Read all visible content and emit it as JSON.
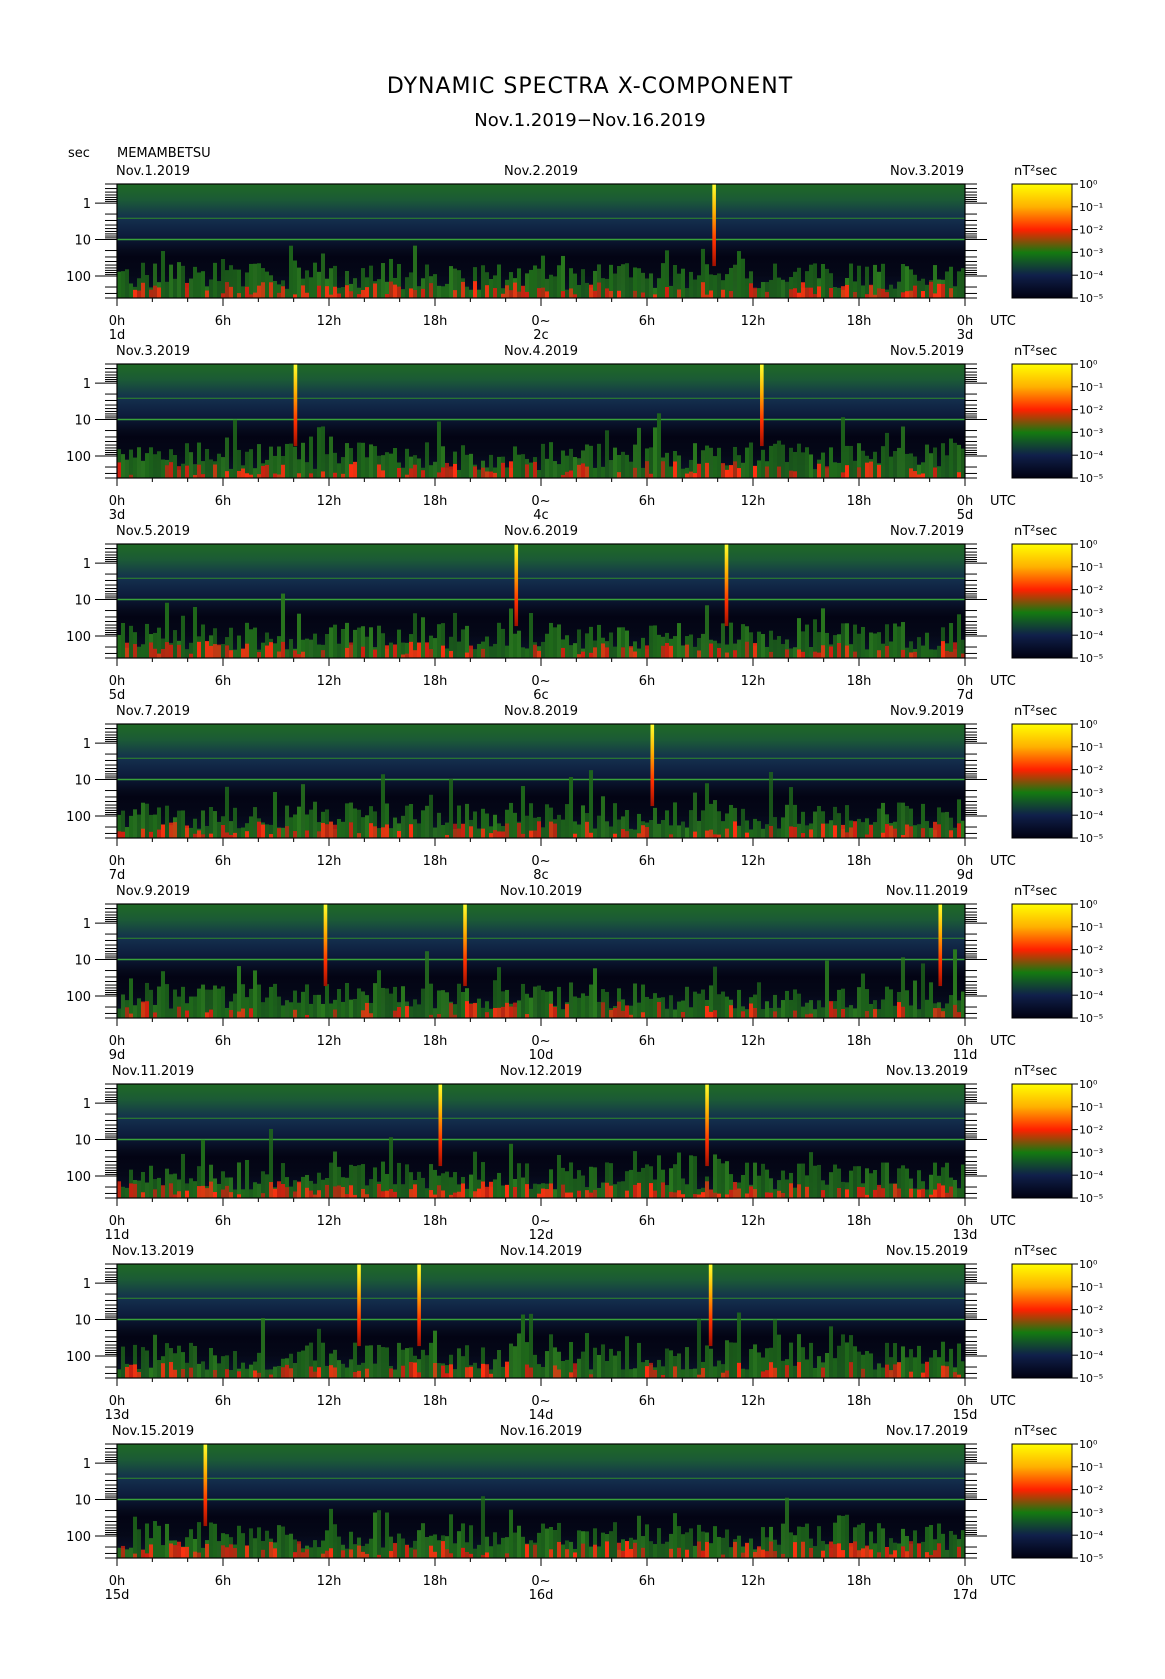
{
  "header": {
    "title": "DYNAMIC SPECTRA X-COMPONENT",
    "subtitle": "Nov.1.2019−Nov.16.2019",
    "axis_unit": "sec",
    "station": "MEMAMBETSU"
  },
  "chart_data": {
    "type": "heatmap",
    "y_axis": {
      "label": "sec",
      "scale": "log",
      "ticks": [
        "1",
        "10",
        "100"
      ],
      "ylim": [
        0.3,
        400
      ]
    },
    "x_ticks": [
      "0h",
      "6h",
      "12h",
      "18h",
      "0~",
      "6h",
      "12h",
      "18h",
      "0h"
    ],
    "time_zone": "UTC",
    "colorbar": {
      "unit": "nT²sec",
      "labels": [
        "10⁰",
        "10⁻¹",
        "10⁻²",
        "10⁻³",
        "10⁻⁴",
        "10⁻⁵"
      ],
      "colors": [
        "#ffff00",
        "#ffb000",
        "#ff2000",
        "#147a10",
        "#10204a",
        "#000010"
      ]
    },
    "panels": [
      {
        "start_date": "Nov.1.2019",
        "mid_date": "Nov.2.2019",
        "end_date": "Nov.3.2019",
        "day_labels": [
          "1d",
          "2c",
          "3d"
        ],
        "spikes_hours": [
          33.8
        ],
        "red_intensity": 0.5
      },
      {
        "start_date": "Nov.3.2019",
        "mid_date": "Nov.4.2019",
        "end_date": "Nov.5.2019",
        "day_labels": [
          "3d",
          "4c",
          "5d"
        ],
        "spikes_hours": [
          10.1,
          36.5
        ],
        "red_intensity": 0.4
      },
      {
        "start_date": "Nov.5.2019",
        "mid_date": "Nov.6.2019",
        "end_date": "Nov.7.2019",
        "day_labels": [
          "5d",
          "6c",
          "7d"
        ],
        "spikes_hours": [
          22.6,
          34.5
        ],
        "red_intensity": 0.45
      },
      {
        "start_date": "Nov.7.2019",
        "mid_date": "Nov.8.2019",
        "end_date": "Nov.9.2019",
        "day_labels": [
          "7d",
          "8c",
          "9d"
        ],
        "spikes_hours": [
          30.3
        ],
        "red_intensity": 0.4
      },
      {
        "start_date": "Nov.9.2019",
        "mid_date": "Nov.10.2019",
        "end_date": "Nov.11.2019",
        "day_labels": [
          "9d",
          "10d",
          "11d"
        ],
        "spikes_hours": [
          11.8,
          19.7,
          46.6
        ],
        "red_intensity": 0.35
      },
      {
        "start_date": "Nov.11.2019",
        "mid_date": "Nov.12.2019",
        "end_date": "Nov.13.2019",
        "day_labels": [
          "11d",
          "12d",
          "13d"
        ],
        "spikes_hours": [
          18.3,
          33.4
        ],
        "red_intensity": 0.55
      },
      {
        "start_date": "Nov.13.2019",
        "mid_date": "Nov.14.2019",
        "end_date": "Nov.15.2019",
        "day_labels": [
          "13d",
          "14d",
          "15d"
        ],
        "spikes_hours": [
          13.7,
          17.1,
          33.6
        ],
        "red_intensity": 0.35
      },
      {
        "start_date": "Nov.15.2019",
        "mid_date": "Nov.16.2019",
        "end_date": "Nov.17.2019",
        "day_labels": [
          "15d",
          "16d",
          "17d"
        ],
        "spikes_hours": [
          5.0
        ],
        "red_intensity": 0.5
      }
    ]
  }
}
